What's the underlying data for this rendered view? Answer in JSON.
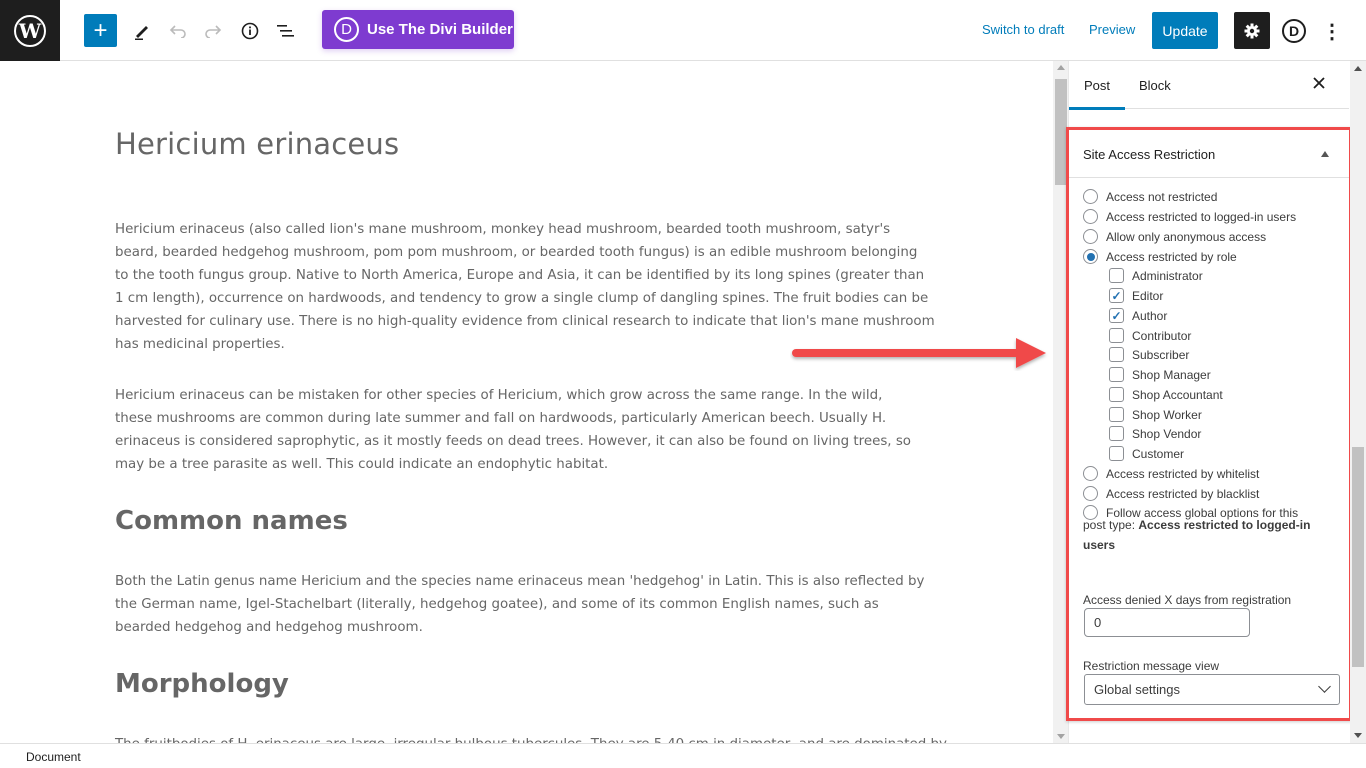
{
  "toolbar": {
    "add_block_icon": "plus-icon",
    "tools_icon": "pencil-icon",
    "undo_icon": "undo-icon",
    "redo_icon": "redo-icon",
    "details_icon": "info-icon",
    "outline_icon": "list-view-icon",
    "divi_button_label": "Use The Divi Builder",
    "divi_letter": "D",
    "switch_to_draft_label": "Switch to draft",
    "preview_label": "Preview",
    "update_label": "Update",
    "settings_icon": "gear-icon",
    "divi_icon_letter": "D",
    "more_icon": "⋮",
    "brand_color": "#007cba",
    "divi_color": "#7e3bd0"
  },
  "post": {
    "title": "Hericium erinaceus",
    "paragraphs": [
      "Hericium erinaceus (also called lion's mane mushroom, monkey head mushroom, bearded tooth mushroom, satyr's beard, bearded hedgehog mushroom, pom pom mushroom, or bearded tooth fungus) is an edible mushroom belonging to the tooth fungus group. Native to North America, Europe and Asia, it can be identified by its long spines (greater than 1 cm length), occurrence on hardwoods, and tendency to grow a single clump of dangling spines. The fruit bodies can be harvested for culinary use. There is no high-quality evidence from clinical research to indicate that lion's mane mushroom has medicinal properties.",
      "Hericium erinaceus can be mistaken for other species of Hericium, which grow across the same range. In the wild, these mushrooms are common during late summer and fall on hardwoods, particularly American beech. Usually H. erinaceus is considered saprophytic, as it mostly feeds on dead trees. However, it can also be found on living trees, so may be a tree parasite as well. This could indicate an endophytic habitat."
    ],
    "heading_common_names": "Common names",
    "common_names_paragraph": "Both the Latin genus name Hericium and the species name erinaceus mean 'hedgehog' in Latin. This is also reflected by the German name, Igel-Stachelbart (literally, hedgehog goatee), and some of its common English names, such as bearded hedgehog and hedgehog mushroom.",
    "heading_morphology": "Morphology",
    "morphology_paragraph": "The fruitbodies of H. erinaceus are large, irregular bulbous tubercules. They are 5-40 cm in diameter, and are dominated by"
  },
  "sidebar": {
    "tabs": [
      {
        "label": "Post",
        "active": true
      },
      {
        "label": "Block",
        "active": false
      }
    ],
    "close_icon": "close-icon",
    "panel": {
      "title": "Site Access Restriction",
      "options": [
        {
          "label": "Access not restricted",
          "checked": false
        },
        {
          "label": "Access restricted to logged-in users",
          "checked": false
        },
        {
          "label": "Allow only anonymous access",
          "checked": false
        },
        {
          "label": "Access restricted by role",
          "checked": true
        }
      ],
      "roles": [
        {
          "label": "Administrator",
          "checked": false
        },
        {
          "label": "Editor",
          "checked": true
        },
        {
          "label": "Author",
          "checked": true
        },
        {
          "label": "Contributor",
          "checked": false
        },
        {
          "label": "Subscriber",
          "checked": false
        },
        {
          "label": "Shop Manager",
          "checked": false
        },
        {
          "label": "Shop Accountant",
          "checked": false
        },
        {
          "label": "Shop Worker",
          "checked": false
        },
        {
          "label": "Shop Vendor",
          "checked": false
        },
        {
          "label": "Customer",
          "checked": false
        }
      ],
      "options_after": [
        {
          "label": "Access restricted by whitelist",
          "checked": false
        },
        {
          "label": "Access restricted by blacklist",
          "checked": false
        },
        {
          "label": "Follow access global options for this",
          "checked": false
        }
      ],
      "global_prefix": "post type: ",
      "global_value": "Access restricted to logged-in users",
      "days_label": "Access denied X days from registration",
      "days_value": "0",
      "message_view_label": "Restriction message view",
      "message_view_value": "Global settings"
    }
  },
  "footer": {
    "breadcrumb": "Document"
  },
  "annotation": {
    "highlight_color": "#f04a4a"
  }
}
